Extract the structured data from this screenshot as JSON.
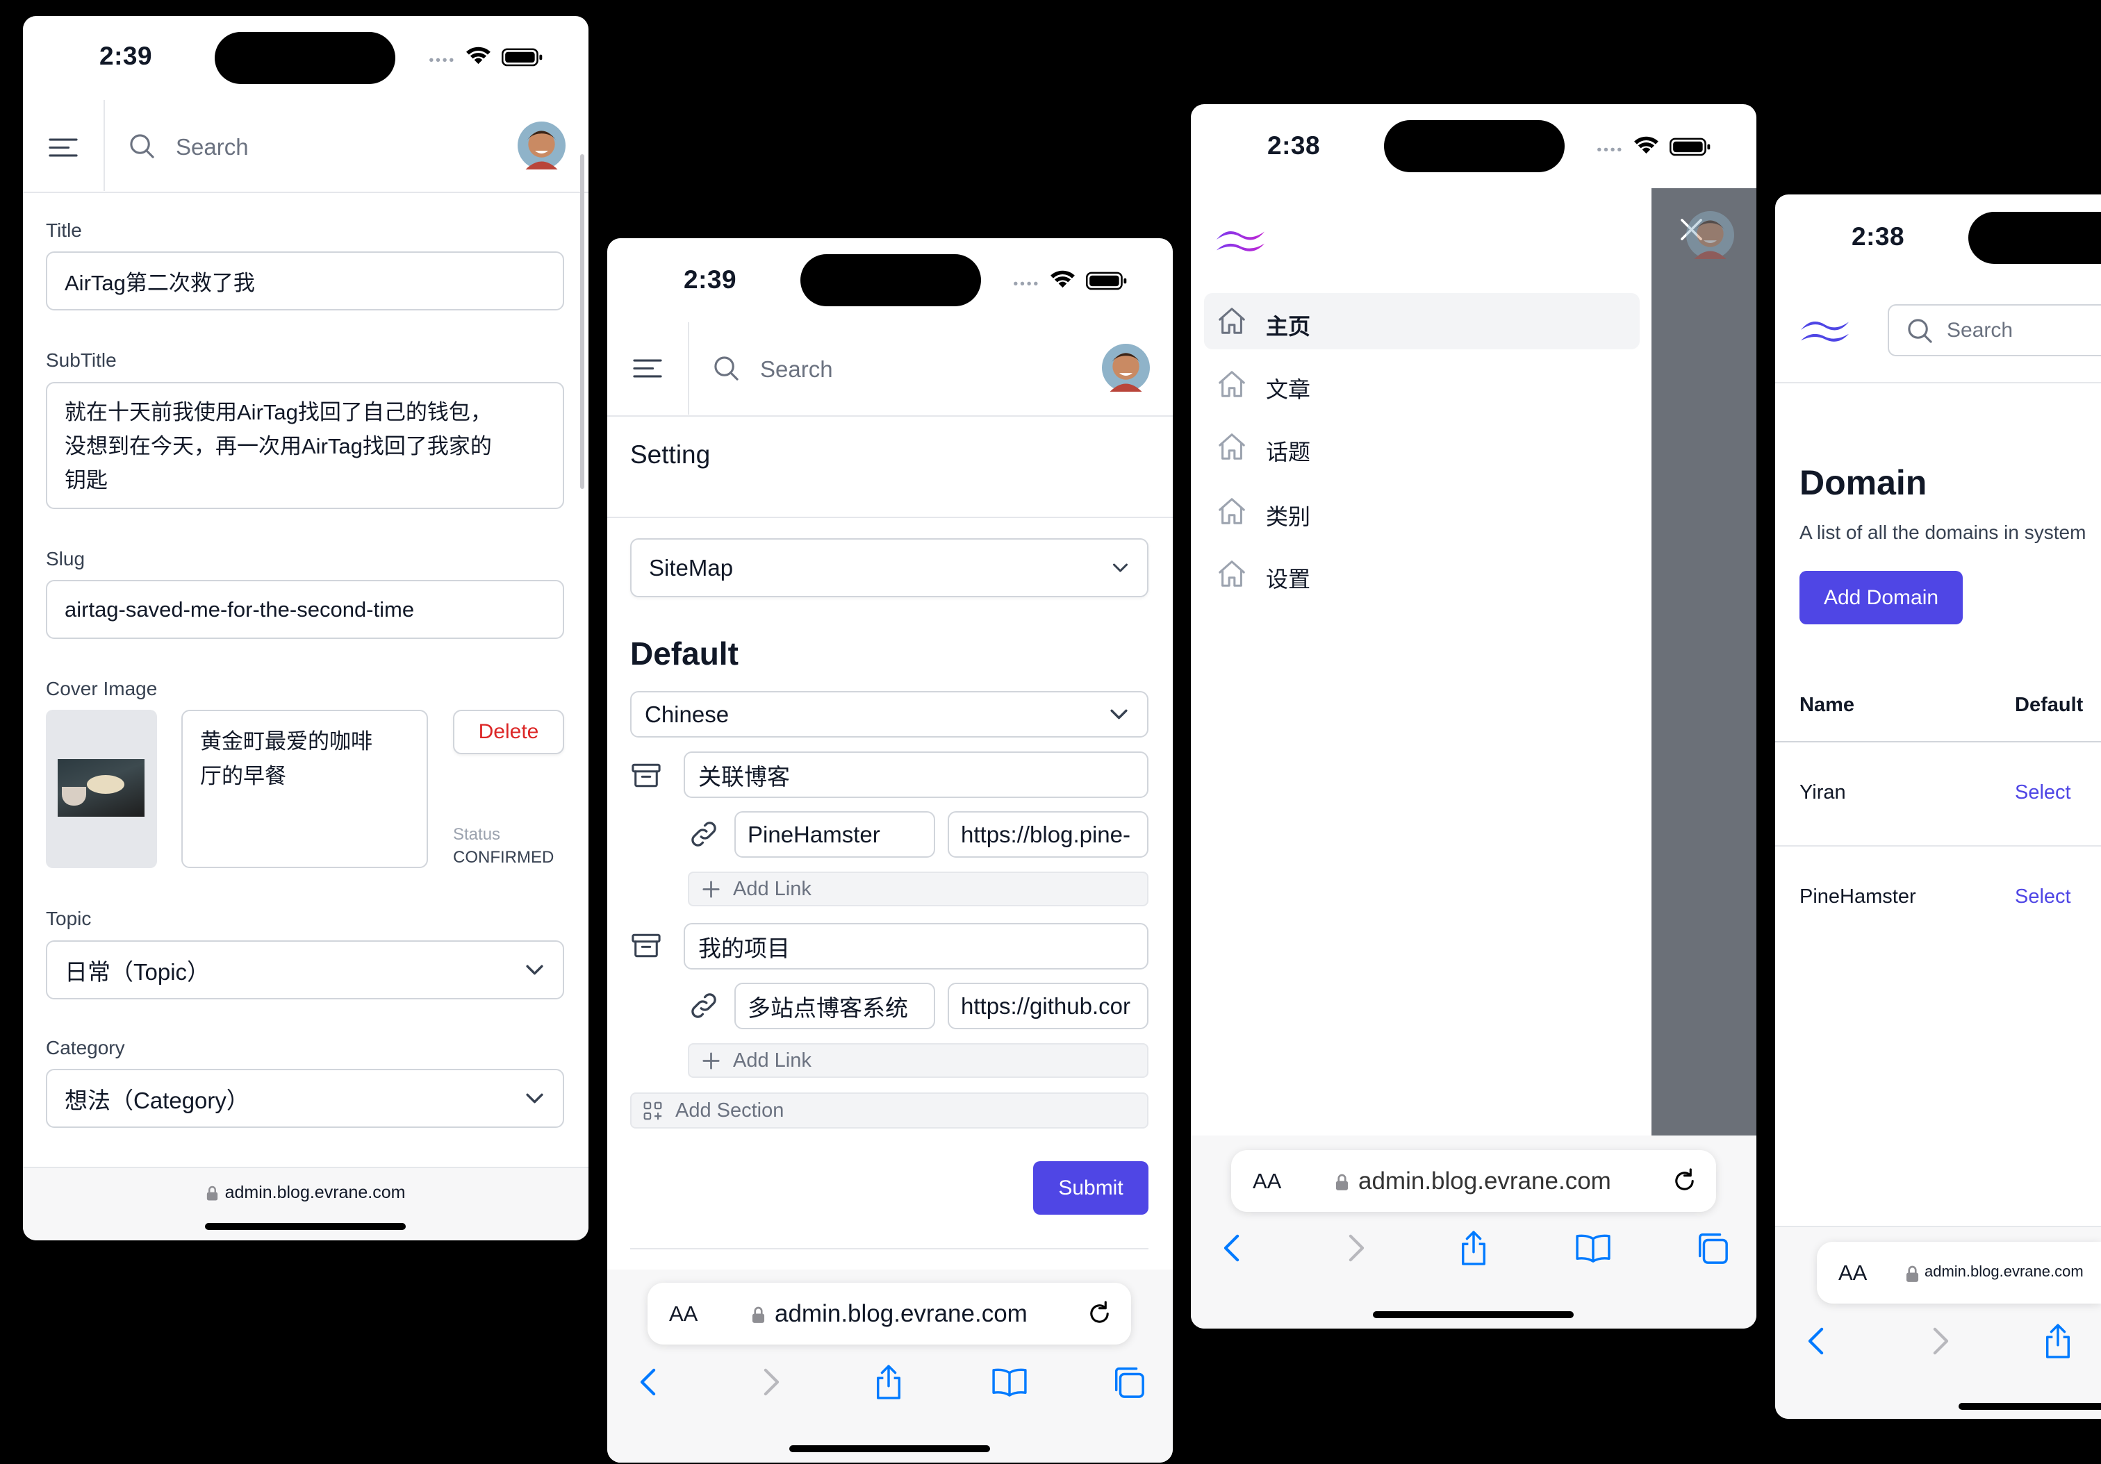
{
  "status_bar": {
    "time_a": "2:39",
    "time_b": "2:38"
  },
  "header": {
    "search_placeholder": "Search"
  },
  "browser": {
    "url": "admin.blog.evrane.com",
    "text_size": "AA"
  },
  "editor": {
    "title_label": "Title",
    "title_value": "AirTag第二次救了我",
    "subtitle_label": "SubTitle",
    "subtitle_lines": [
      "就在十天前我使用AirTag找回了自己的钱包，",
      "没想到在今天，再一次用AirTag找回了我家的",
      "钥匙"
    ],
    "slug_label": "Slug",
    "slug_value": "airtag-saved-me-for-the-second-time",
    "cover_label": "Cover Image",
    "cover_caption_lines": [
      "黄金町最爱的咖啡",
      "厅的早餐"
    ],
    "delete_label": "Delete",
    "status_label": "Status",
    "status_value": "CONFIRMED",
    "topic_label": "Topic",
    "topic_value": "日常（Topic）",
    "category_label": "Category",
    "category_value": "想法（Category）"
  },
  "setting": {
    "title": "Setting",
    "section_select": "SiteMap",
    "default_heading": "Default",
    "language_select": "Chinese",
    "sections": [
      {
        "name": "关联博客",
        "link_name": "PineHamster",
        "link_url": "https://blog.pine-"
      },
      {
        "name": "我的项目",
        "link_name": "多站点博客系统",
        "link_url": "https://github.cor"
      }
    ],
    "add_link_label": "Add Link",
    "add_section_label": "Add Section",
    "submit_label": "Submit"
  },
  "menu": {
    "items": [
      {
        "label": "主页",
        "active": true
      },
      {
        "label": "文章"
      },
      {
        "label": "话题"
      },
      {
        "label": "类别"
      },
      {
        "label": "设置"
      }
    ]
  },
  "domain": {
    "title": "Domain",
    "description": "A list of all the domains in system",
    "add_label": "Add Domain",
    "columns": [
      "Name",
      "Default"
    ],
    "rows": [
      {
        "name": "Yiran",
        "action": "Select"
      },
      {
        "name": "PineHamster",
        "action": "Select"
      }
    ]
  },
  "colors": {
    "accent": "#4f46e5",
    "danger": "#dc2626",
    "safari_blue": "#007aff",
    "overlay": "#6b7078"
  }
}
